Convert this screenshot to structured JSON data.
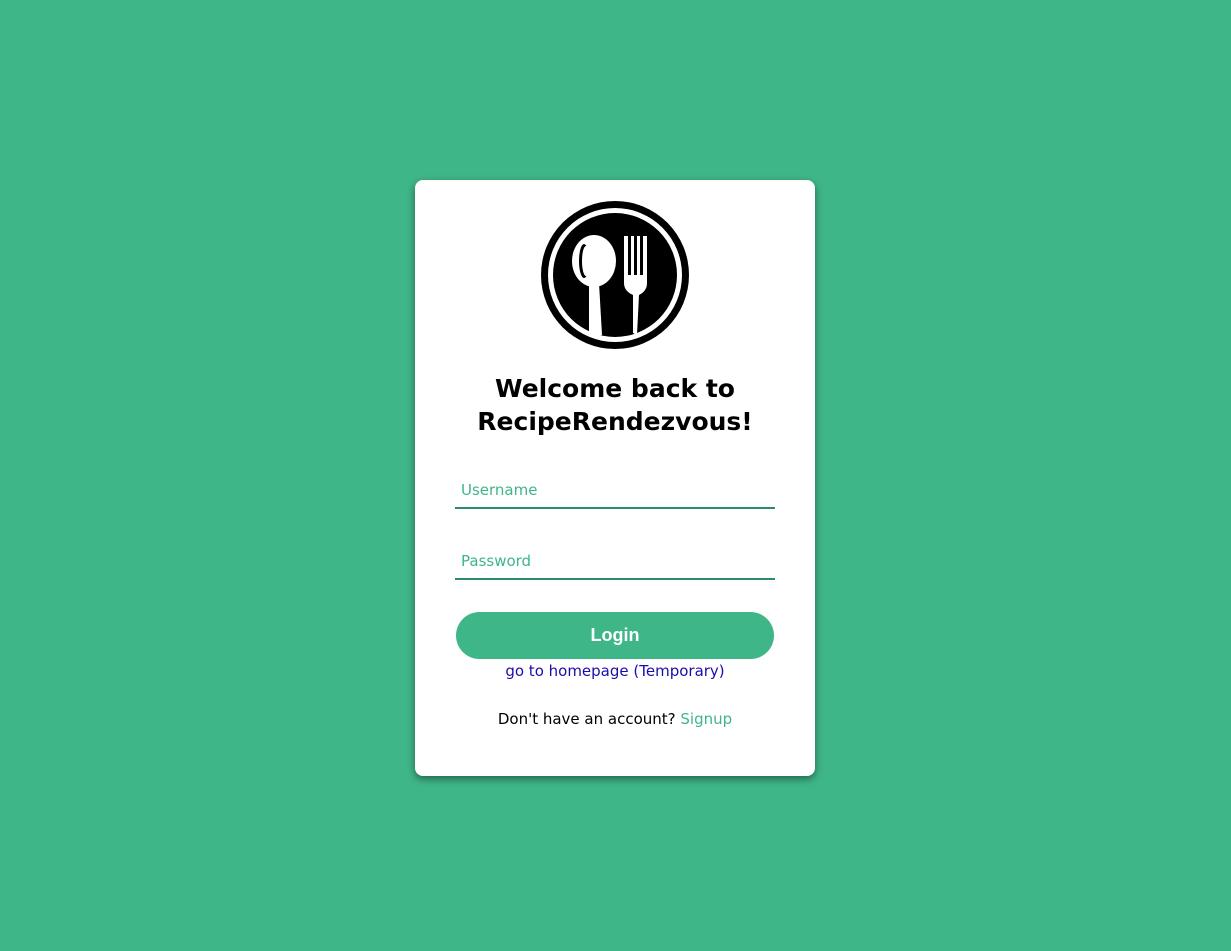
{
  "page": {
    "background_color": "#3fb688"
  },
  "logo": {
    "icon": "spoon-and-fork-icon"
  },
  "header": {
    "title_line1": "Welcome back to",
    "title_line2": "RecipeRendezvous!"
  },
  "form": {
    "username_placeholder": "Username",
    "username_value": "",
    "password_placeholder": "Password",
    "password_value": "",
    "login_label": "Login",
    "accent_color": "#3fb688"
  },
  "links": {
    "homepage_label": "go to homepage (Temporary)",
    "signup_prompt": "Don't have an account?",
    "signup_label": "Signup"
  }
}
